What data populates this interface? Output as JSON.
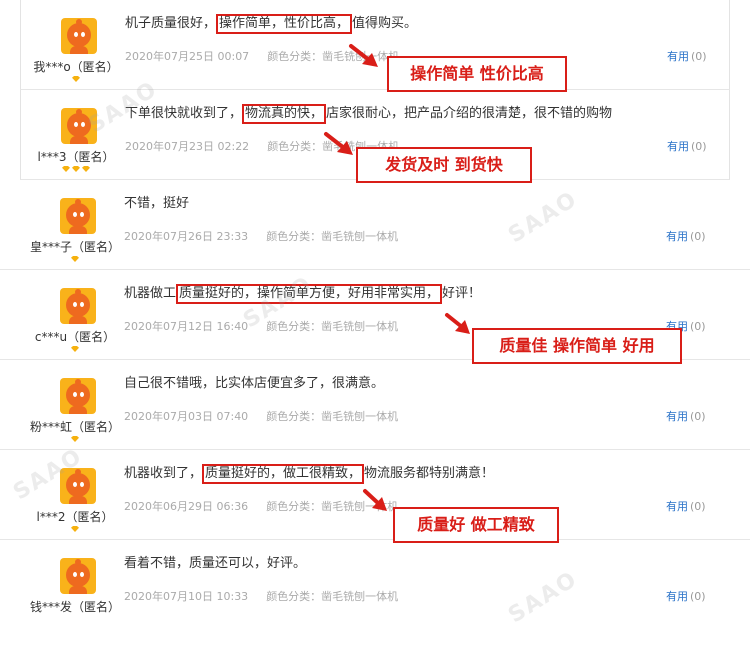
{
  "reviews": [
    {
      "user": "我***o（匿名）",
      "badges": 1,
      "pre": "机子质量很好，",
      "highlight": "操作简单，性价比高，",
      "post": "值得购买。",
      "date": "2020年07月25日 00:07",
      "category": "颜色分类：凿毛铣刨一体机",
      "useful_label": "有用",
      "useful_count": "(0)"
    },
    {
      "user": "l***3（匿名）",
      "badges": 3,
      "pre": "下单很快就收到了，",
      "highlight": "物流真的快，",
      "post": "店家很耐心，把产品介绍的很清楚，很不错的购物",
      "date": "2020年07月23日 02:22",
      "category": "颜色分类：凿毛铣刨一体机",
      "useful_label": "有用",
      "useful_count": "(0)"
    },
    {
      "user": "皇***子（匿名）",
      "badges": 1,
      "pre": "不错，挺好",
      "highlight": "",
      "post": "",
      "date": "2020年07月26日 23:33",
      "category": "颜色分类：凿毛铣刨一体机",
      "useful_label": "有用",
      "useful_count": "(0)"
    },
    {
      "user": "c***u（匿名）",
      "badges": 1,
      "pre": "机器做工",
      "highlight": "质量挺好的，操作简单方便，好用非常实用，",
      "post": "好评！",
      "date": "2020年07月12日 16:40",
      "category": "颜色分类：凿毛铣刨一体机",
      "useful_label": "有用",
      "useful_count": "(0)"
    },
    {
      "user": "粉***虹（匿名）",
      "badges": 1,
      "pre": "自己很不错哦，比实体店便宜多了，很满意。",
      "highlight": "",
      "post": "",
      "date": "2020年07月03日 07:40",
      "category": "颜色分类：凿毛铣刨一体机",
      "useful_label": "有用",
      "useful_count": "(0)"
    },
    {
      "user": "l***2（匿名）",
      "badges": 1,
      "pre": "机器收到了，",
      "highlight": "质量挺好的，做工很精致，",
      "post": "物流服务都特别满意！",
      "date": "2020年06月29日 06:36",
      "category": "颜色分类：凿毛铣刨一体机",
      "useful_label": "有用",
      "useful_count": "(0)"
    },
    {
      "user": "钱***发（匿名）",
      "badges": 0,
      "pre": "看着不错，质量还可以，好评。",
      "highlight": "",
      "post": "",
      "date": "2020年07月10日 10:33",
      "category": "颜色分类：凿毛铣刨一体机",
      "useful_label": "有用",
      "useful_count": "(0)"
    }
  ],
  "callouts": [
    "操作简单 性价比高",
    "发货及时 到货快",
    "质量佳 操作简单 好用",
    "质量好 做工精致"
  ],
  "watermark": "SAAO",
  "colors": {
    "accent_red": "#d91e18",
    "link_blue": "#2a72c8",
    "badge_gold": "#f6b10e"
  },
  "icons": {
    "avatar": "orange-mascot-avatar-icon",
    "badge": "gold-diamond-badge-icon",
    "arrow": "red-pointer-arrow-icon"
  }
}
